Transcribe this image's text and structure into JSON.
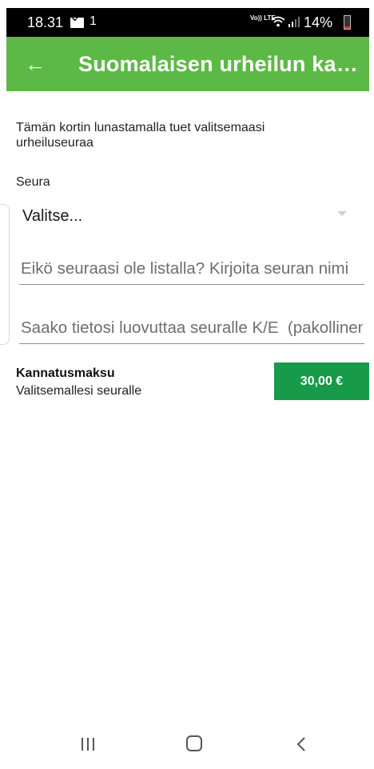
{
  "status_bar": {
    "time": "18.31",
    "notification": "1",
    "network": "Vo)) LTE",
    "battery": "14%",
    "icons": [
      "mail-icon",
      "wifi-icon",
      "signal-icon",
      "battery-icon"
    ]
  },
  "app_bar": {
    "back_icon": "←",
    "title": "Suomalaisen urheilun kannatuskortti"
  },
  "content": {
    "intro": "Tämän kortin lunastamalla tuet valitsemaasi urheiluseuraa",
    "club_label": "Seura",
    "club_select_value": "Valitse...",
    "club_input_placeholder": "Eikö seuraasi ole listalla? Kirjoita seuran nimi",
    "consent_placeholder": "Saako tietosi luovuttaa seuralle K/E  (pakollinen)",
    "fee_title": "Kannatusmaksu",
    "fee_subtitle": "Valitsemallesi seuralle",
    "fee_price": "30,00 €"
  },
  "colors": {
    "app_bar": "#5db945",
    "price_button": "#179a49",
    "status_bar": "#000000"
  }
}
